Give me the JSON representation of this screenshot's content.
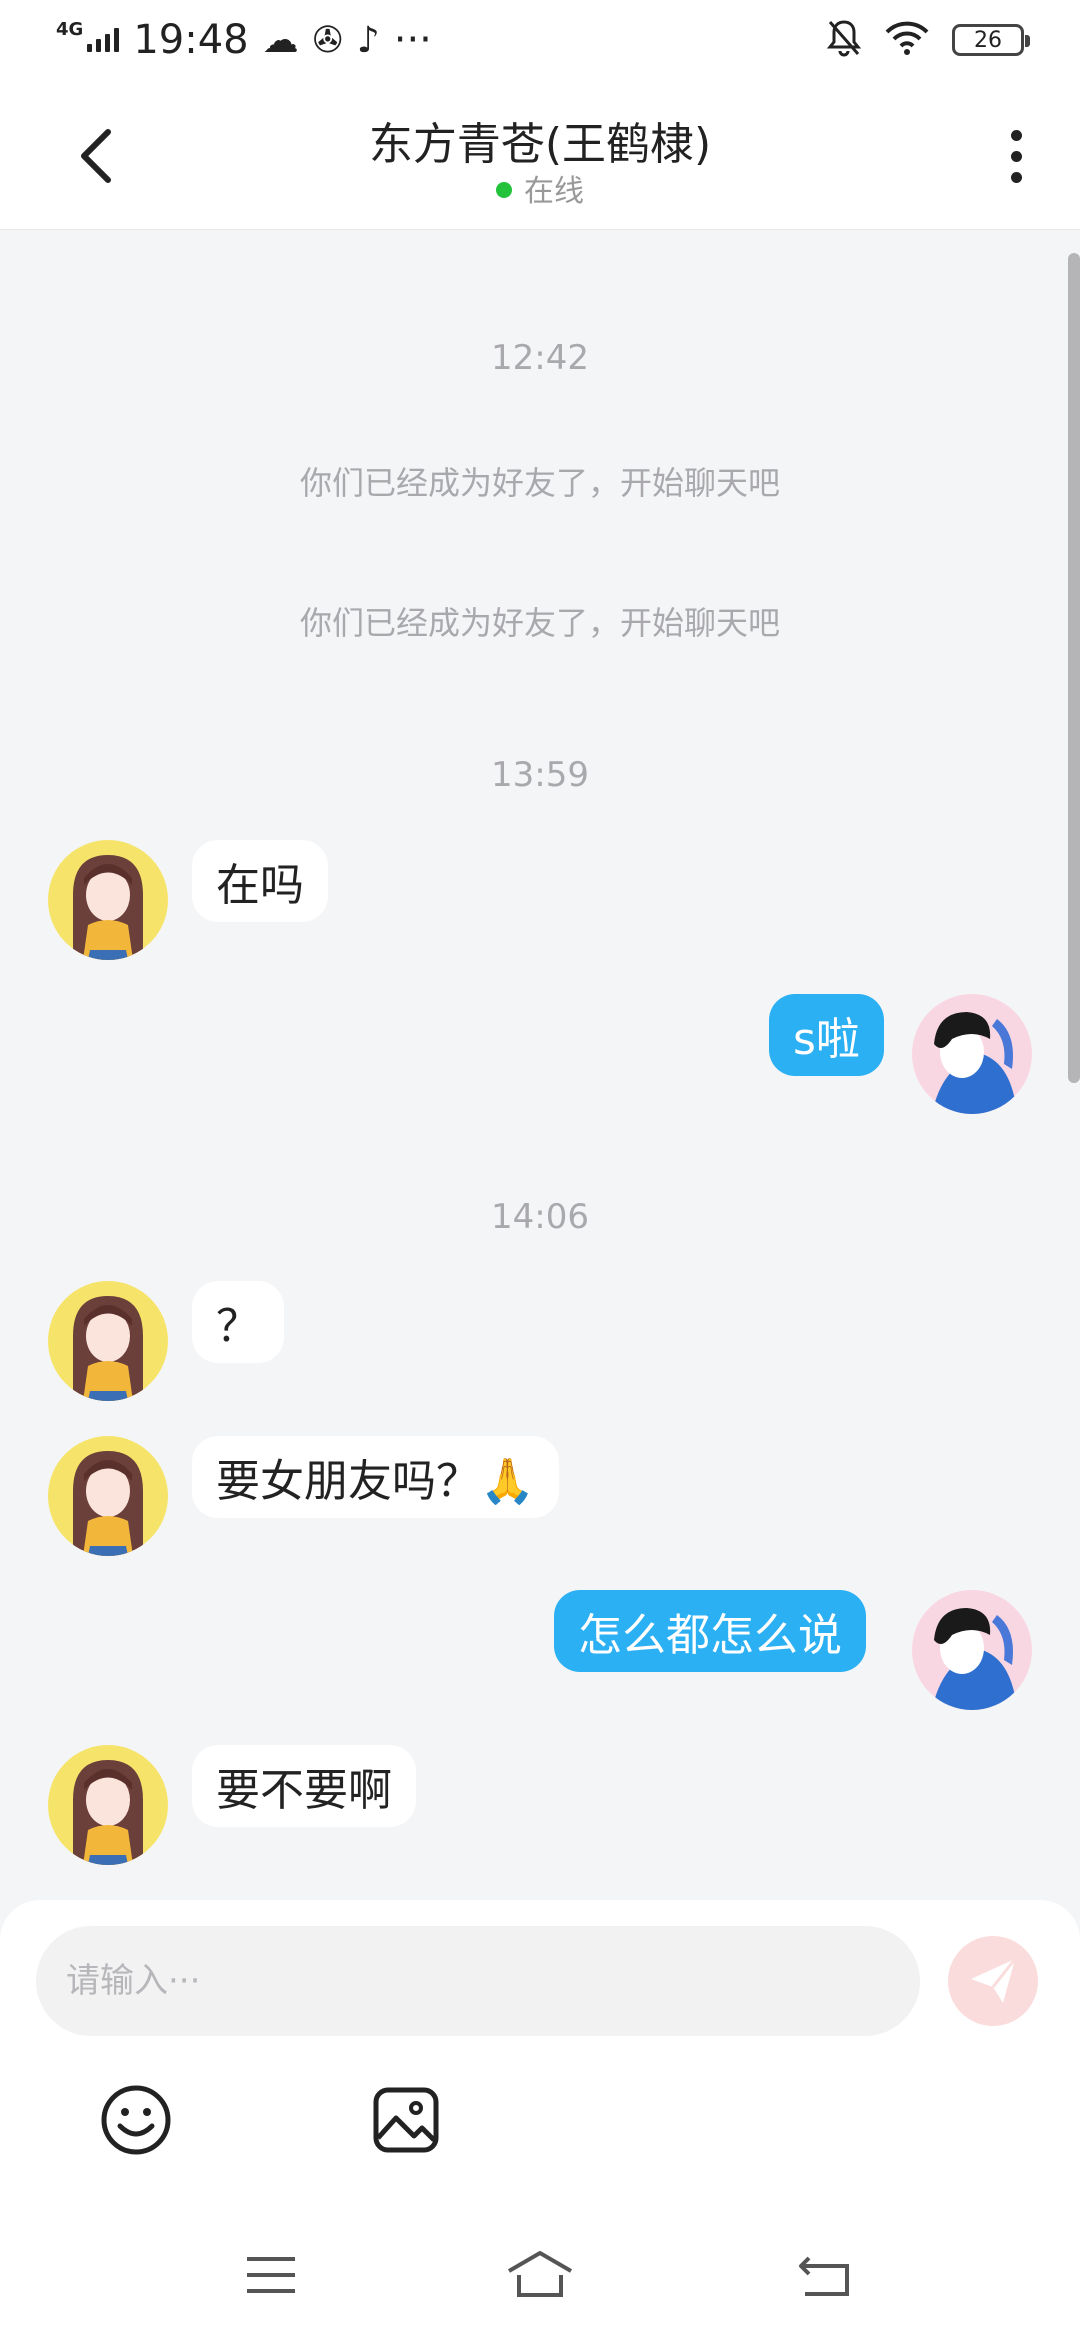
{
  "status_bar": {
    "network": "4G",
    "time": "19:48",
    "more": "···",
    "battery": "26"
  },
  "header": {
    "title": "东方青苍(王鹤棣)",
    "online_status": "在线"
  },
  "messages": {
    "time_1": "12:42",
    "system_1": "你们已经成为好友了，开始聊天吧",
    "system_2": "你们已经成为好友了，开始聊天吧",
    "time_2": "13:59",
    "msg_1": "在吗",
    "msg_2": "s啦",
    "time_3": "14:06",
    "msg_3": "？",
    "msg_4": "要女朋友吗？🙏",
    "msg_5": "怎么都怎么说",
    "msg_6": "要不要啊"
  },
  "input": {
    "placeholder": "请输入···"
  },
  "icons": {
    "back": "back-arrow-icon",
    "more": "more-vertical-icon",
    "send": "send-icon",
    "emoji": "emoji-icon",
    "image": "image-icon",
    "nav_menu": "menu-icon",
    "nav_home": "home-icon",
    "nav_back": "back-icon"
  },
  "colors": {
    "accent": "#2cb0f4",
    "online": "#22c33a",
    "send_button": "#fbdcdc"
  }
}
